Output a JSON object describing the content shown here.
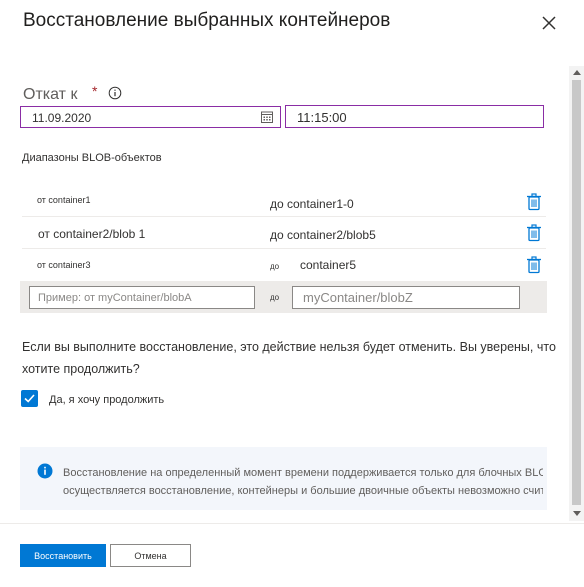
{
  "dialog": {
    "title": "Восстановление выбранных контейнеров"
  },
  "restore_point": {
    "label": "Откат к",
    "required_mark": "*",
    "date_value": "11.09.2020",
    "time_value": "11:15:00"
  },
  "blob_ranges": {
    "label": "Диапазоны BLOB-объектов",
    "rows": [
      {
        "from": "от container1",
        "to": "до container1-0"
      },
      {
        "from": "от container2/blob 1",
        "to": "до container2/blob5"
      },
      {
        "from": "от container3",
        "to_prefix": "до",
        "to": "container5"
      }
    ],
    "new_row": {
      "from_placeholder": "Пример: от myContainer/blobA",
      "to_prefix": "до",
      "to_placeholder": "myContainer/blobZ"
    }
  },
  "confirm": {
    "question": "Если вы выполните восстановление, это действие нельзя будет отменить. Вы уверены, что хотите продолжить?",
    "checkbox_label": "Да, я хочу продолжить",
    "checked": true
  },
  "info": {
    "line1": "Восстановление на определенный момент времени поддерживается только для блочных BLOB-объектов",
    "line2": "осуществляется восстановление, контейнеры и большие двоичные объекты невозможно считать или"
  },
  "footer": {
    "restore_button": "Восстановить",
    "cancel_button": "Отмена"
  },
  "colors": {
    "accent": "#0078d4",
    "focus_border": "#8a2da5",
    "required": "#a4262c"
  }
}
